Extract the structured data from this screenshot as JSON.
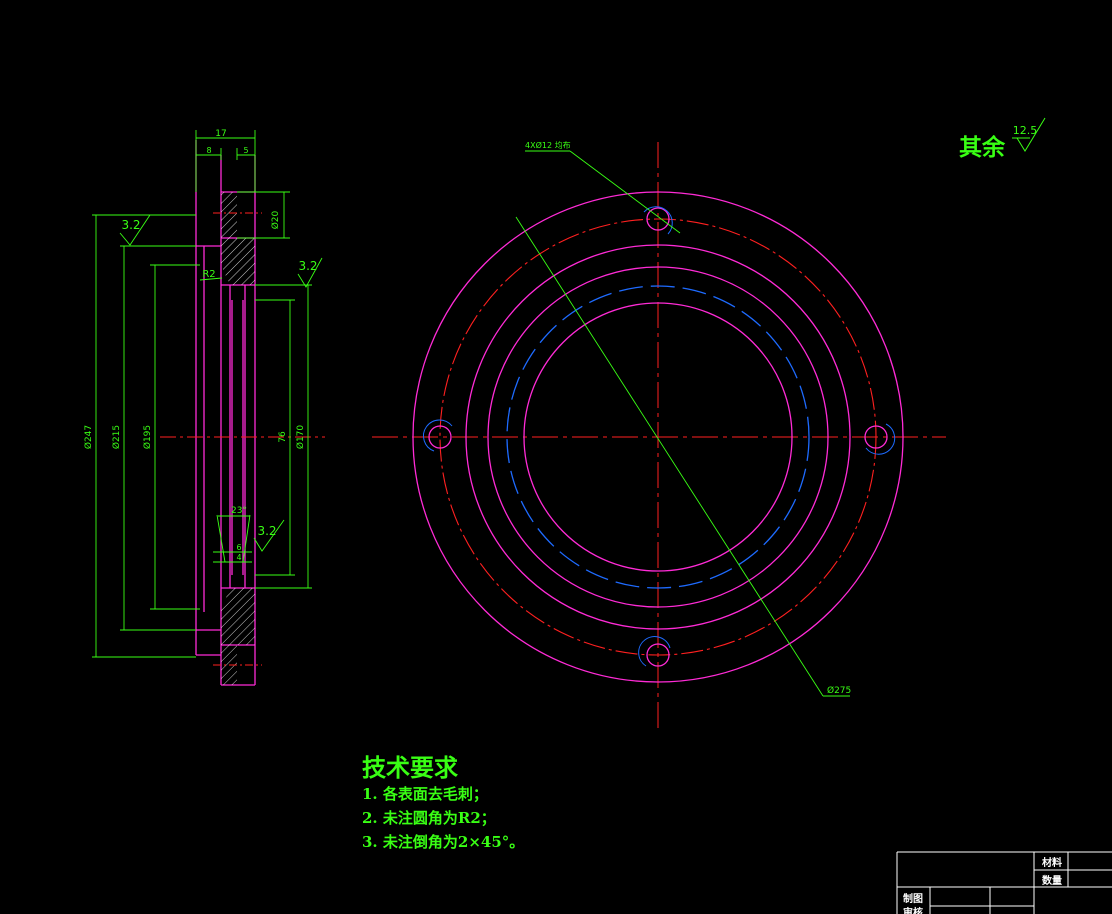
{
  "drawing": {
    "surface_finish_rest": {
      "label": "其余",
      "value": "12.5"
    },
    "section_view": {
      "dim_total_width": "17",
      "dim_left_width": "8",
      "dim_right_width": "5",
      "dim_bolt_hole": "Ø20",
      "roughness_outer": "3.2",
      "roughness_inner": "3.2",
      "roughness_groove": "3.2",
      "fillet": "R2",
      "dim_d247": "Ø247",
      "dim_d215": "Ø215",
      "dim_d195": "Ø195",
      "dim_76": "76",
      "dim_d170": "Ø170",
      "groove_angle": "23°",
      "groove_width_6": "6",
      "groove_width_4": "4"
    },
    "front_view": {
      "holes_callout": "4XØ12 均布",
      "dim_d275": "Ø275"
    }
  },
  "tech_requirements": {
    "title": "技术要求",
    "items": [
      "1. 各表面去毛刺；",
      "2. 未注圆角为R2；",
      "3. 未注倒角为2×45°。"
    ]
  },
  "title_block": {
    "material_label": "材料",
    "quantity_label": "数量",
    "drawn_label": "制图",
    "checked_label": "审核"
  },
  "colors": {
    "outline": "#ff2bd6",
    "dimension": "#39ff14",
    "centerline": "#ff2020",
    "hidden": "#1e6bff",
    "hatch": "#ffffff",
    "background": "#000000"
  }
}
